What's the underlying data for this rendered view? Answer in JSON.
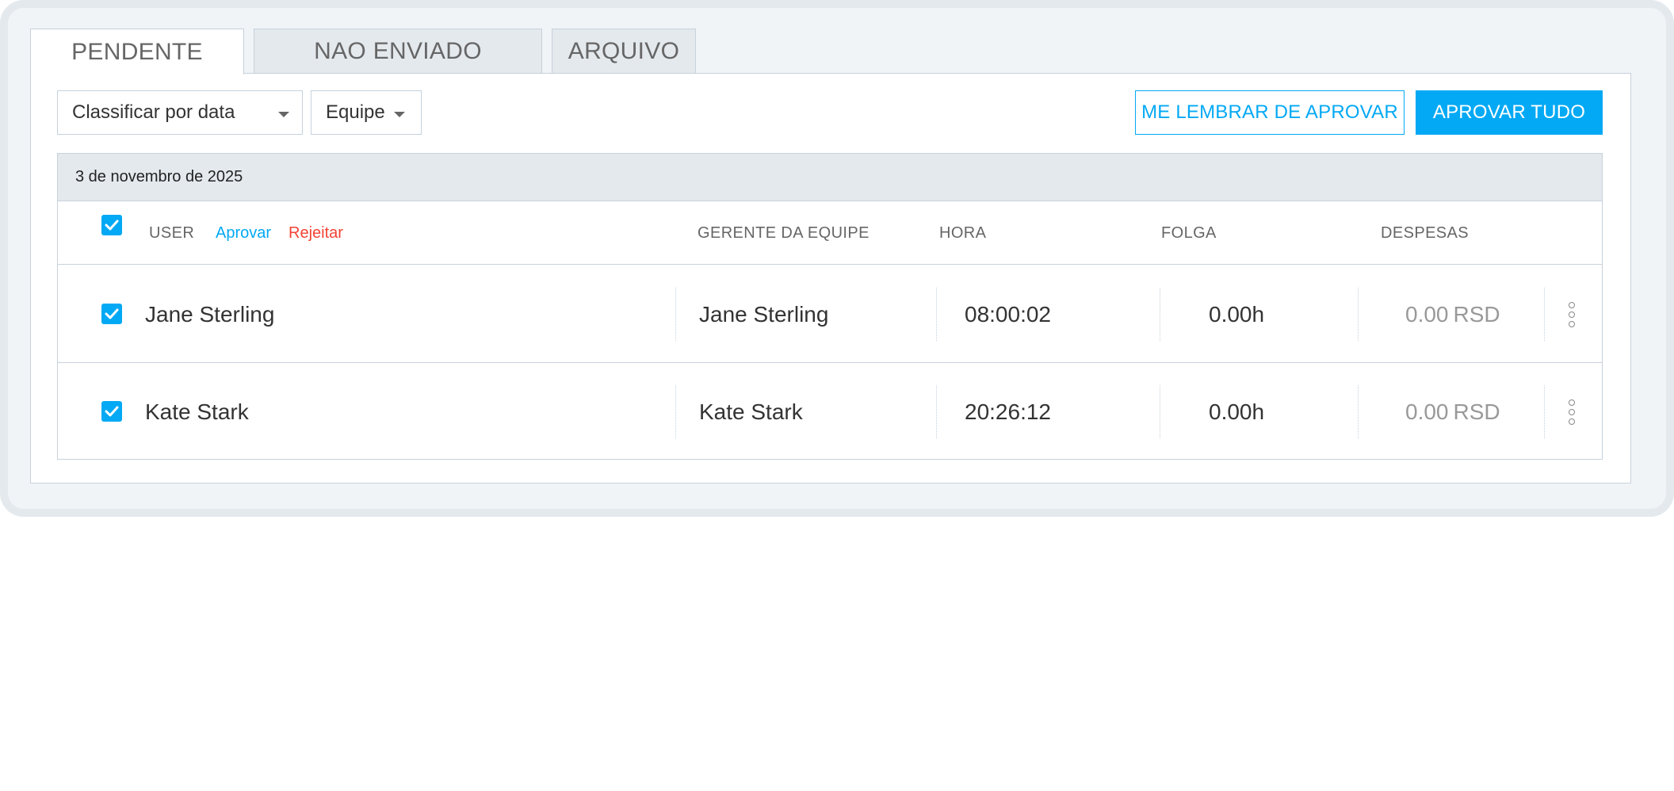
{
  "tabs": [
    {
      "label": "PENDENTE",
      "active": true
    },
    {
      "label": "NAO ENVIADO",
      "active": false
    },
    {
      "label": "ARQUIVO",
      "active": false
    }
  ],
  "toolbar": {
    "sort_select": "Classificar por data",
    "team_select": "Equipe",
    "remind_button": "ME LEMBRAR DE APROVAR",
    "approve_all_button": "APROVAR TUDO"
  },
  "table": {
    "date_label": "3 de novembro de 2025",
    "headers": {
      "user": "USER",
      "approve": "Aprovar",
      "reject": "Rejeitar",
      "manager": "GERENTE DA EQUIPE",
      "time": "HORA",
      "time_off": "FOLGA",
      "expenses": "DESPESAS"
    },
    "rows": [
      {
        "user": "Jane Sterling",
        "manager": "Jane Sterling",
        "time": "08:00:02",
        "time_off": "0.00h",
        "expense_amount": "0.00",
        "expense_currency": "RSD",
        "checked": true
      },
      {
        "user": "Kate Stark",
        "manager": "Kate Stark",
        "time": "20:26:12",
        "time_off": "0.00h",
        "expense_amount": "0.00",
        "expense_currency": "RSD",
        "checked": true
      }
    ]
  },
  "colors": {
    "accent": "#03a9f4",
    "reject": "#f44336",
    "border": "#c6d2dc",
    "frame": "#e4e9ee"
  },
  "icons": {
    "checkbox": "check-icon",
    "select_caret": "caret-down-icon",
    "row_menu": "more-vertical-icon"
  }
}
